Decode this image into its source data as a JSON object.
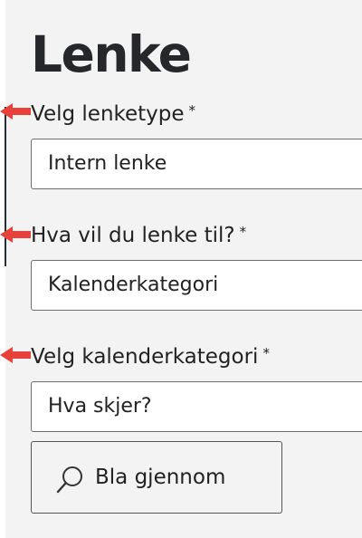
{
  "page": {
    "title": "Lenke"
  },
  "fields": [
    {
      "label": "Velg lenketype",
      "required_mark": "*",
      "value": "Intern lenke"
    },
    {
      "label": "Hva vil du lenke til?",
      "required_mark": "*",
      "value": "Kalenderkategori"
    },
    {
      "label": "Velg kalenderkategori",
      "required_mark": "*",
      "value": "Hva skjer?"
    }
  ],
  "browse_button": {
    "label": "Bla gjennom",
    "icon": "search-icon"
  },
  "colors": {
    "annotation_arrow": "#e8413a",
    "panel_background": "#f3f3f3",
    "left_rule": "#25303d"
  }
}
